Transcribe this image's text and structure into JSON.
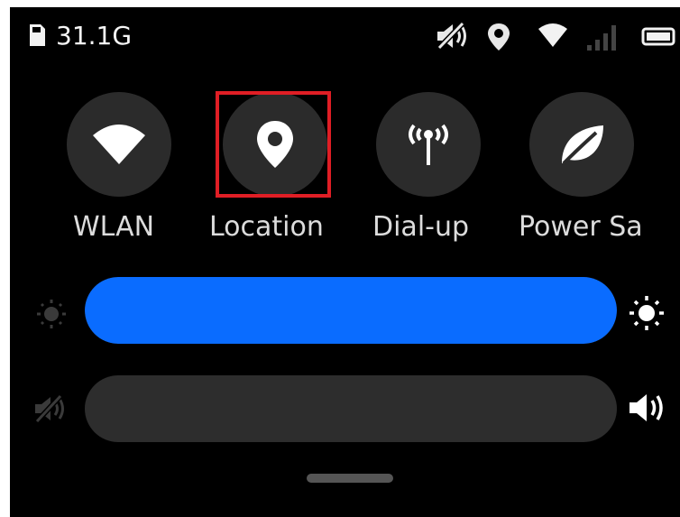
{
  "status_bar": {
    "storage": "31.1G",
    "icons": [
      "sd-card-icon",
      "mute-icon",
      "location-icon",
      "wifi-icon",
      "signal-icon",
      "battery-icon"
    ]
  },
  "quick_settings": {
    "tiles": [
      {
        "label": "WLAN",
        "icon": "wifi-icon"
      },
      {
        "label": "Location",
        "icon": "location-pin-icon",
        "highlighted": true
      },
      {
        "label": "Dial-up",
        "icon": "antenna-icon"
      },
      {
        "label": "Power Sa",
        "icon": "leaf-icon"
      }
    ]
  },
  "brightness": {
    "level_fraction": 1.0,
    "min_icon": "sun-dim-icon",
    "max_icon": "sun-bright-icon"
  },
  "volume": {
    "level_fraction": 0.0,
    "min_icon": "mute-icon",
    "max_icon": "speaker-icon"
  },
  "colors": {
    "background": "#000000",
    "tile_background": "#2b2b2b",
    "accent": "#0a6cff",
    "highlight": "#e01e25",
    "track": "#2d2d2d"
  }
}
